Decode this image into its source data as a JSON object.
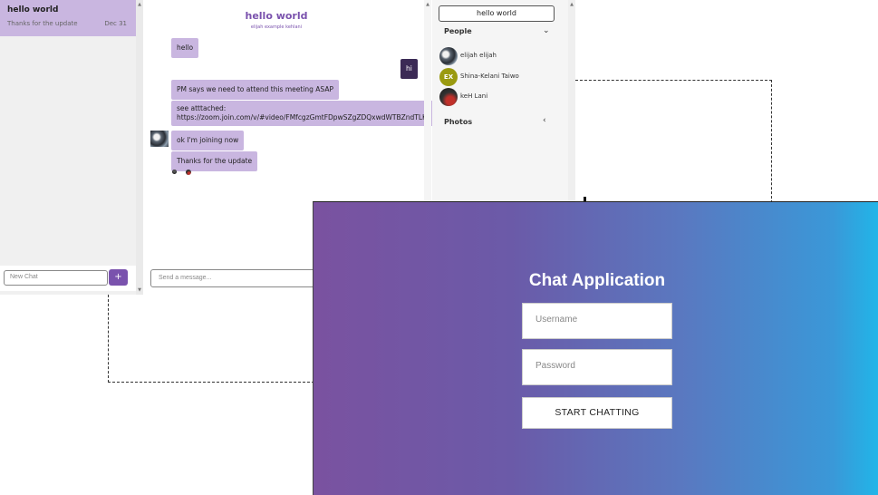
{
  "chat_list": {
    "items": [
      {
        "title": "hello world",
        "last_message": "Thanks for the update",
        "date": "Dec 31"
      }
    ],
    "new_chat_placeholder": "New Chat",
    "new_chat_button": "+"
  },
  "feed": {
    "title": "hello world",
    "subtitle": "elijah example kehlani",
    "messages": [
      {
        "text": "hello",
        "mine": false
      },
      {
        "text": "hi",
        "mine": true
      },
      {
        "text": "PM says we need to attend this meeting ASAP",
        "mine": false
      },
      {
        "text_line1": "see atttached:",
        "text_line2": "https://zoom.join.com/v/#video/FMfcgzGmtFDpwSZgZDQxwdWTBZndTLKl",
        "mine": false
      },
      {
        "text": "ok I'm joining now",
        "mine": false
      },
      {
        "text": "Thanks for the update",
        "mine": false
      }
    ],
    "message_placeholder": "Send a message..."
  },
  "settings": {
    "title": "hello world",
    "people_label": "People",
    "people": [
      {
        "name": "elijah elijah",
        "initials": ""
      },
      {
        "name": "Shina-Kelani Taiwo",
        "initials": "EX"
      },
      {
        "name": "keH Lani",
        "initials": ""
      }
    ],
    "photos_label": "Photos"
  },
  "login": {
    "title": "Chat Application",
    "username_placeholder": "Username",
    "password_placeholder": "Password",
    "submit_label": "START CHATTING"
  },
  "colors": {
    "accent": "#7a52ad",
    "bubble": "#c9b6e0",
    "my_bubble": "#3b2a55",
    "gradient_start": "#7a52a0",
    "gradient_end": "#21b5e8"
  }
}
